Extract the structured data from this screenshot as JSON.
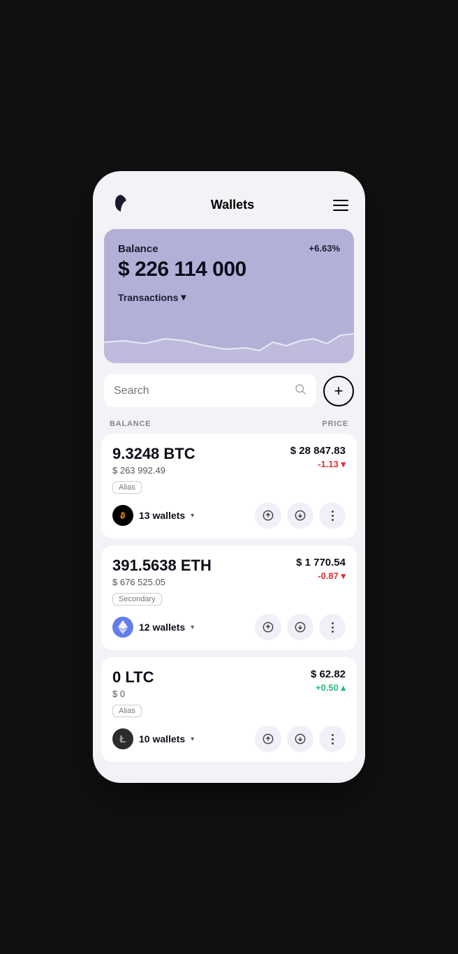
{
  "header": {
    "title": "Wallets",
    "menu_label": "menu"
  },
  "balance_card": {
    "label": "Balance",
    "percent": "+6.63%",
    "amount": "$ 226 114 000",
    "transactions_label": "Transactions",
    "chart_color": "rgba(255,255,255,0.6)"
  },
  "search": {
    "placeholder": "Search",
    "add_label": "+"
  },
  "table_headers": {
    "balance": "BALANCE",
    "price": "PRICE"
  },
  "coins": [
    {
      "id": "btc",
      "amount": "9.3248 BTC",
      "usd_value": "$ 263 992.49",
      "tag": "Alias",
      "wallets_count": "13 wallets",
      "price": "$ 28 847.83",
      "change": "-1.13",
      "change_positive": false,
      "logo_symbol": "₿",
      "logo_class": ""
    },
    {
      "id": "eth",
      "amount": "391.5638 ETH",
      "usd_value": "$ 676 525.05",
      "tag": "Secondary",
      "wallets_count": "12 wallets",
      "price": "$ 1 770.54",
      "change": "-0.87",
      "change_positive": false,
      "logo_symbol": "♦",
      "logo_class": "eth"
    },
    {
      "id": "ltc",
      "amount": "0 LTC",
      "usd_value": "$ 0",
      "tag": "Alias",
      "wallets_count": "10 wallets",
      "price": "$ 62.82",
      "change": "+0.50",
      "change_positive": true,
      "logo_symbol": "Ł",
      "logo_class": "ltc"
    }
  ]
}
